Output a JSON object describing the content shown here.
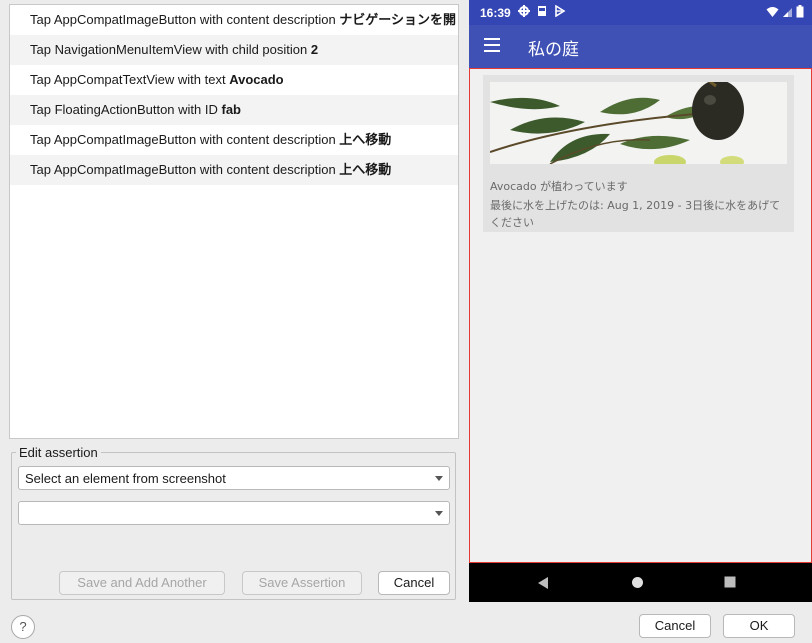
{
  "actions": [
    {
      "prefix": "Tap AppCompatImageButton with content description ",
      "value": "ナビゲーションを開く"
    },
    {
      "prefix": "Tap NavigationMenuItemView with child position ",
      "value": "2"
    },
    {
      "prefix": "Tap AppCompatTextView with text ",
      "value": "Avocado"
    },
    {
      "prefix": "Tap FloatingActionButton with ID ",
      "value": "fab"
    },
    {
      "prefix": "Tap AppCompatImageButton with content description ",
      "value": "上へ移動"
    },
    {
      "prefix": "Tap AppCompatImageButton with content description ",
      "value": "上へ移動"
    }
  ],
  "edit_assertion": {
    "legend": "Edit assertion",
    "element_select": "Select an element from screenshot",
    "assertion_select": "",
    "save_add_label": "Save and Add Another",
    "save_label": "Save Assertion",
    "cancel_label": "Cancel"
  },
  "footer": {
    "help_label": "?",
    "cancel_label": "Cancel",
    "ok_label": "OK"
  },
  "device": {
    "time": "16:39",
    "app_title": "私の庭",
    "plant_name": "Avocado が植わっています",
    "plant_watered": "最後に水を上げたのは: Aug 1, 2019 - 3日後に水をあげてください",
    "colors": {
      "status_bar": "#3445b4",
      "app_bar": "#3f51b5",
      "selection_border": "#e53935"
    }
  }
}
